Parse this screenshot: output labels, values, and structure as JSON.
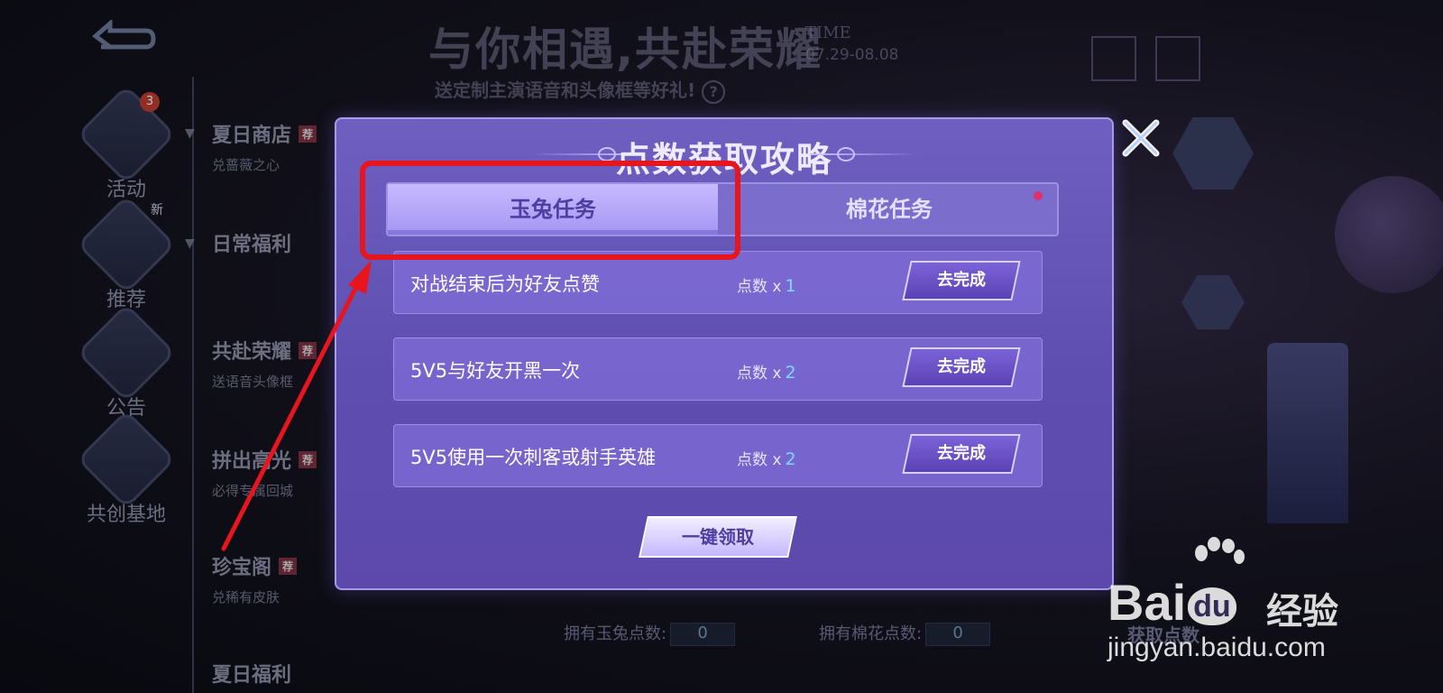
{
  "background": {
    "title": "与你相遇,共赴荣耀",
    "time_label": "TIME",
    "date_range": "07.29-08.08",
    "subtitle": "送定制主演语音和头像框等好礼!",
    "owned_rabbit_label": "拥有玉兔点数:",
    "owned_rabbit_value": "0",
    "owned_cotton_label": "拥有棉花点数:",
    "owned_cotton_value": "0",
    "get_points_label": "获取点数"
  },
  "sidebar": {
    "items": [
      {
        "label": "活动",
        "badge": "3"
      },
      {
        "label": "推荐",
        "badge": "新"
      },
      {
        "label": "公告"
      },
      {
        "label": "共创基地"
      }
    ]
  },
  "menu": {
    "entries": [
      {
        "title": "夏日商店",
        "tag": "荐",
        "sub": "兑蔷薇之心"
      },
      {
        "title": "日常福利"
      },
      {
        "title": "共赴荣耀",
        "tag": "荐",
        "sub": "送语音头像框"
      },
      {
        "title": "拼出高光",
        "tag": "荐",
        "sub": "必得专属回城"
      },
      {
        "title": "珍宝阁",
        "tag": "荐",
        "sub": "兑稀有皮肤"
      },
      {
        "title": "夏日福利"
      }
    ]
  },
  "modal": {
    "title": "点数获取攻略",
    "tabs": [
      {
        "label": "玉兔任务",
        "active": true
      },
      {
        "label": "棉花任务",
        "active": false
      }
    ],
    "points_label": "点数 x",
    "tasks": [
      {
        "name": "对战结束后为好友点赞",
        "points": "1",
        "button": "去完成"
      },
      {
        "name": "5V5与好友开黑一次",
        "points": "2",
        "button": "去完成"
      },
      {
        "name": "5V5使用一次刺客或射手英雄",
        "points": "2",
        "button": "去完成"
      }
    ],
    "claim_all": "一键领取"
  },
  "watermark": {
    "brand": "Bai",
    "brand2": "du",
    "suffix": "经验",
    "url": "jingyan.baidu.com"
  },
  "colors": {
    "highlight": "#e8141e",
    "modal_bg": "#6e5fc0",
    "accent_num": "#7fd8ff"
  }
}
